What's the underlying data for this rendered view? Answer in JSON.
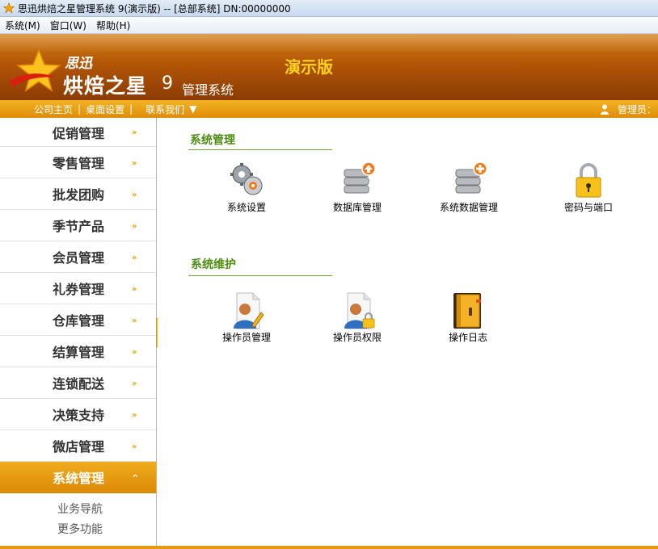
{
  "window": {
    "title": "思迅烘焙之星管理系统 9(演示版) -- [总部系统] DN:00000000"
  },
  "menubar": [
    {
      "label": "系统(M)"
    },
    {
      "label": "窗口(W)"
    },
    {
      "label": "帮助(H)"
    }
  ],
  "banner": {
    "brand_small": "思迅",
    "brand_big": "烘焙之星",
    "brand_version": "9",
    "brand_sub": "管理系统",
    "edition": "演示版"
  },
  "navbar": {
    "items": [
      {
        "label": "公司主页"
      },
      {
        "label": "桌面设置"
      },
      {
        "label": "联系我们"
      }
    ],
    "separator": "|",
    "dropdown_glyph": "▼",
    "user_label": "管理员："
  },
  "sidebar": {
    "items": [
      {
        "label": "促销管理"
      },
      {
        "label": "零售管理"
      },
      {
        "label": "批发团购"
      },
      {
        "label": "季节产品"
      },
      {
        "label": "会员管理"
      },
      {
        "label": "礼券管理"
      },
      {
        "label": "仓库管理"
      },
      {
        "label": "结算管理"
      },
      {
        "label": "连锁配送"
      },
      {
        "label": "决策支持"
      },
      {
        "label": "微店管理"
      }
    ],
    "active": {
      "label": "系统管理"
    },
    "sub_items": [
      {
        "label": "业务导航"
      },
      {
        "label": "更多功能"
      }
    ],
    "chevron_down": "»",
    "chevron_up": "^"
  },
  "main": {
    "sections": [
      {
        "title": "系统管理",
        "tiles": [
          {
            "label": "系统设置",
            "icon": "gears-icon"
          },
          {
            "label": "数据库管理",
            "icon": "database-upload-icon"
          },
          {
            "label": "系统数据管理",
            "icon": "database-add-icon"
          },
          {
            "label": "密码与端口",
            "icon": "padlock-icon"
          }
        ]
      },
      {
        "title": "系统维护",
        "tiles": [
          {
            "label": "操作员管理",
            "icon": "user-edit-icon"
          },
          {
            "label": "操作员权限",
            "icon": "user-lock-icon"
          },
          {
            "label": "操作日志",
            "icon": "log-book-icon"
          }
        ]
      }
    ]
  },
  "colors": {
    "banner": "#a54b06",
    "accent": "#f0a81c",
    "section_title": "#4d8d12",
    "edition": "#ffd21e"
  }
}
